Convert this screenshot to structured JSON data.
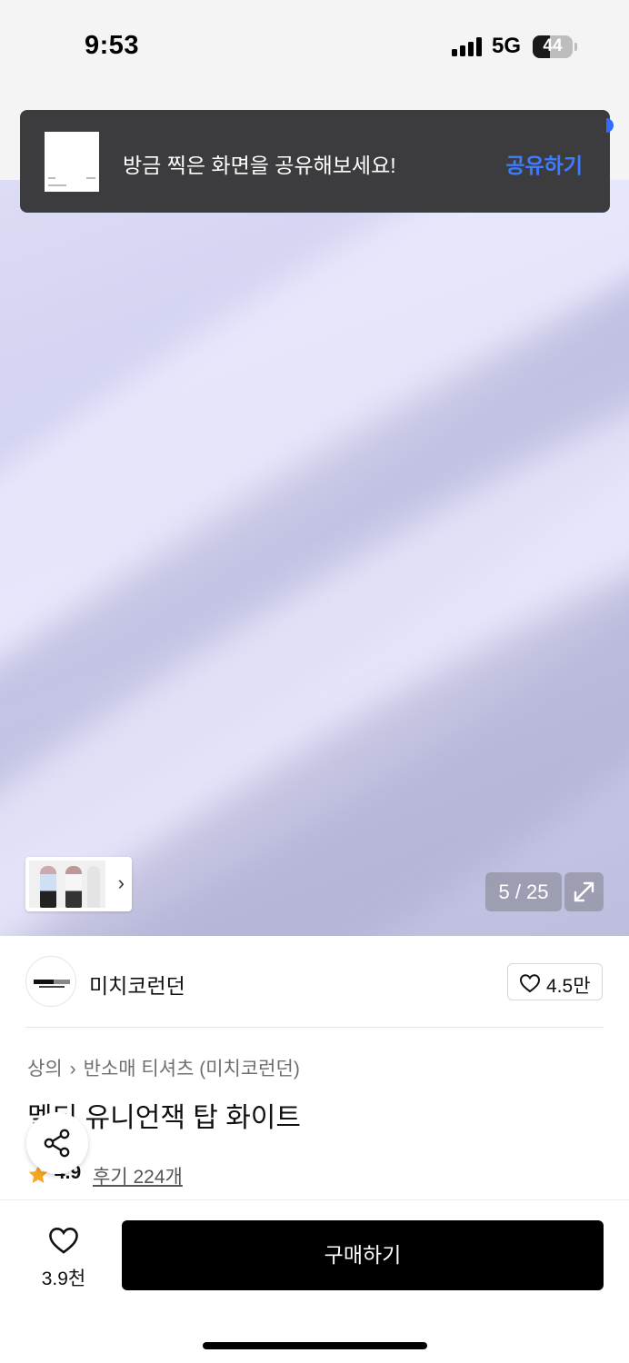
{
  "status_bar": {
    "time": "9:53",
    "network": "5G",
    "battery": "44",
    "battery_level": 0.44
  },
  "toast": {
    "message": "방금 찍은 화면을 공유해보세요!",
    "action": "공유하기"
  },
  "gallery": {
    "counter": "5 / 25",
    "thumbnail_icon": "chevron-right-icon",
    "expand_icon": "expand-icon"
  },
  "brand": {
    "name": "미치코런던",
    "likes": "4.5만"
  },
  "product": {
    "breadcrumb": [
      "상의",
      "반소매 티셔츠 (미치코런던)"
    ],
    "title": "멜티 유니언잭 탑 화이트",
    "rating": "4.9",
    "reviews": "후기 224개"
  },
  "bottom_bar": {
    "wish_count": "3.9천",
    "buy_label": "구매하기"
  },
  "colors": {
    "accent": "#3d7bff",
    "toast_bg": "#3c3c3e",
    "star": "#f5a623",
    "buy_bg": "#000000"
  }
}
